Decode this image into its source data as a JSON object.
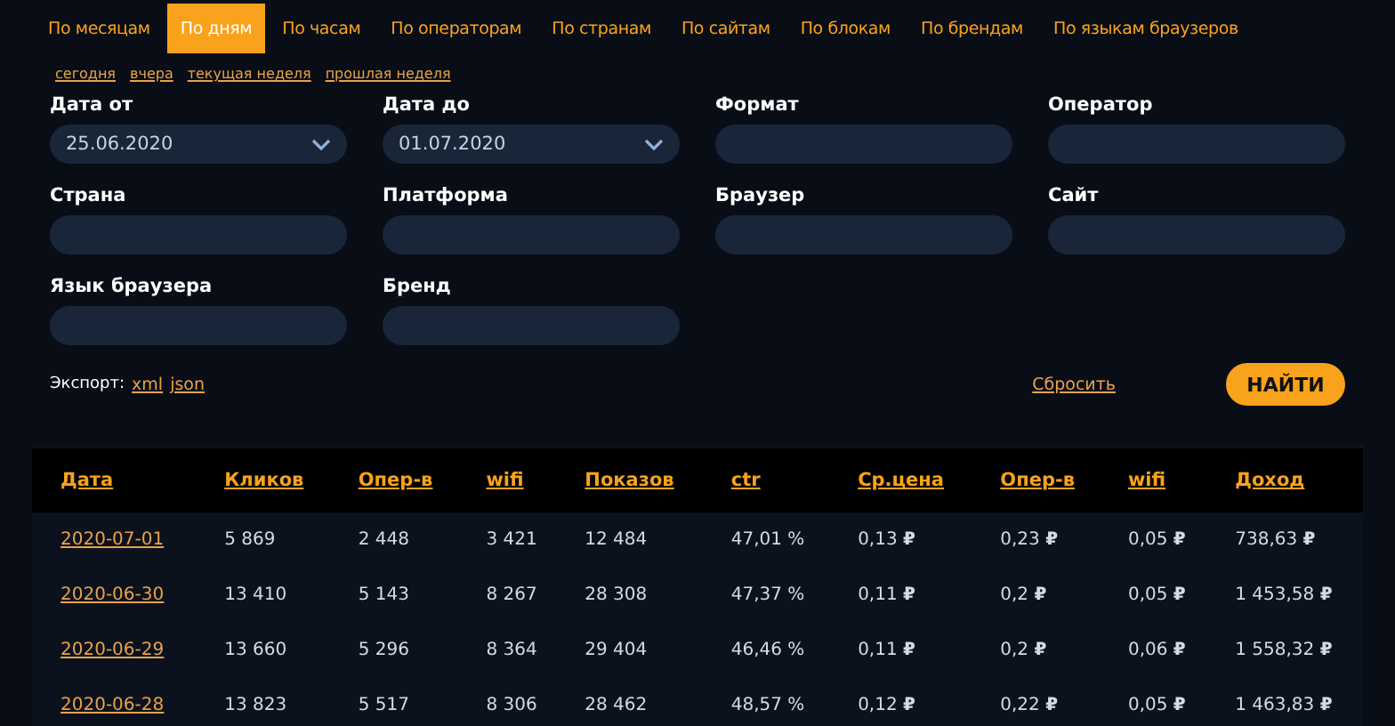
{
  "tabs": [
    {
      "label": "По месяцам",
      "selected": false
    },
    {
      "label": "По дням",
      "selected": true
    },
    {
      "label": "По часам",
      "selected": false
    },
    {
      "label": "По операторам",
      "selected": false
    },
    {
      "label": "По странам",
      "selected": false
    },
    {
      "label": "По сайтам",
      "selected": false
    },
    {
      "label": "По блокам",
      "selected": false
    },
    {
      "label": "По брендам",
      "selected": false
    },
    {
      "label": "По языкам браузеров",
      "selected": false
    }
  ],
  "presets": [
    "сегодня",
    "вчера",
    "текущая неделя",
    "прошлая неделя"
  ],
  "filters": [
    {
      "label": "Дата от",
      "kind": "select",
      "value": "25.06.2020"
    },
    {
      "label": "Дата до",
      "kind": "select",
      "value": "01.07.2020"
    },
    {
      "label": "Формат",
      "kind": "text"
    },
    {
      "label": "Оператор",
      "kind": "text"
    },
    {
      "label": "Страна",
      "kind": "text"
    },
    {
      "label": "Платформа",
      "kind": "text"
    },
    {
      "label": "Браузер",
      "kind": "text"
    },
    {
      "label": "Сайт",
      "kind": "text"
    },
    {
      "label": "Язык браузера",
      "kind": "text"
    },
    {
      "label": "Бренд",
      "kind": "text"
    }
  ],
  "export": {
    "label": "Экспорт:",
    "links": [
      "xml",
      "json"
    ]
  },
  "reset": "Сбросить",
  "submit": "НАЙТИ",
  "table": {
    "columns": [
      "Дата",
      "Кликов",
      "Опер-в",
      "wifi",
      "Показов",
      "ctr",
      "Ср.цена",
      "Опер-в",
      "wifi",
      "Доход"
    ],
    "rows": [
      [
        "2020-07-01",
        "5 869",
        "2 448",
        "3 421",
        "12 484",
        "47,01 %",
        "0,13 **₽**",
        "0,23 **₽**",
        "0,05 **₽**",
        "738,63 **₽**"
      ],
      [
        "2020-06-30",
        "13 410",
        "5 143",
        "8 267",
        "28 308",
        "47,37 %",
        "0,11 **₽**",
        "0,2 **₽**",
        "0,05 **₽**",
        "1 453,58 **₽**"
      ],
      [
        "2020-06-29",
        "13 660",
        "5 296",
        "8 364",
        "29 404",
        "46,46 %",
        "0,11 **₽**",
        "0,2 **₽**",
        "0,06 **₽**",
        "1 558,32 **₽**"
      ],
      [
        "2020-06-28",
        "13 823",
        "5 517",
        "8 306",
        "28 462",
        "48,57 %",
        "0,12 **₽**",
        "0,22 **₽**",
        "0,05 **₽**",
        "1 463,83 **₽**"
      ]
    ]
  }
}
